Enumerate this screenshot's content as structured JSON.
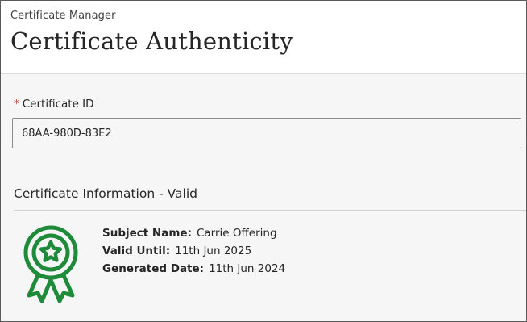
{
  "header": {
    "breadcrumb": "Certificate Manager",
    "title": "Certificate Authenticity"
  },
  "form": {
    "required_marker": "*",
    "field_label": "Certificate ID",
    "field_value": "68AA-980D-83E2"
  },
  "certificate": {
    "section_title": "Certificate Information - Valid",
    "icon": "award-ribbon-icon",
    "icon_color": "#1e8a3a",
    "details": [
      {
        "label": "Subject Name:",
        "value": "Carrie Offering"
      },
      {
        "label": "Valid Until:",
        "value": "11th Jun 2025"
      },
      {
        "label": "Generated Date:",
        "value": "11th Jun 2024"
      }
    ]
  }
}
